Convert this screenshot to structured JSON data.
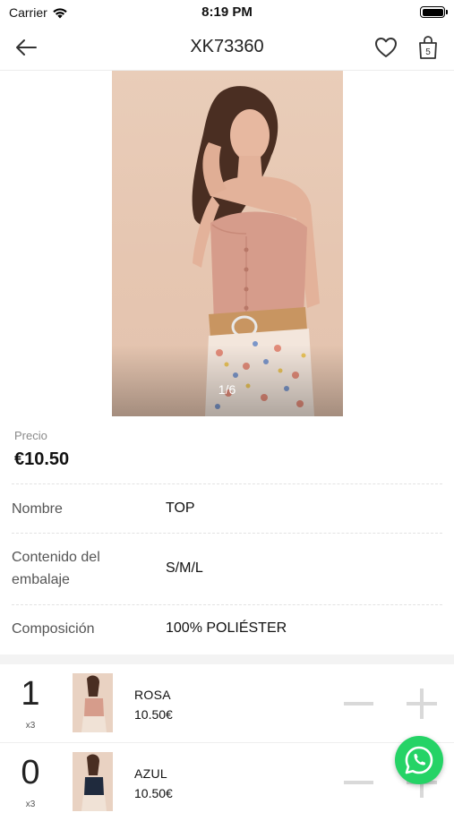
{
  "status_bar": {
    "carrier": "Carrier",
    "time": "8:19 PM"
  },
  "header": {
    "title": "XK73360",
    "cart_count": "5"
  },
  "gallery": {
    "pager": "1/6"
  },
  "price": {
    "label": "Precio",
    "value": "€10.50"
  },
  "details": [
    {
      "label": "Nombre",
      "value": "TOP"
    },
    {
      "label": "Contenido del embalaje",
      "value": "S/M/L"
    },
    {
      "label": "Composición",
      "value": "100% POLIÉSTER"
    }
  ],
  "variants": [
    {
      "qty": "1",
      "multiplier": "x3",
      "name": "ROSA",
      "price": "10.50€",
      "color": "#d69c8b"
    },
    {
      "qty": "0",
      "multiplier": "x3",
      "name": "AZUL",
      "price": "10.50€",
      "color": "#1f2a3d"
    }
  ],
  "colors": {
    "whatsapp": "#25d366"
  }
}
